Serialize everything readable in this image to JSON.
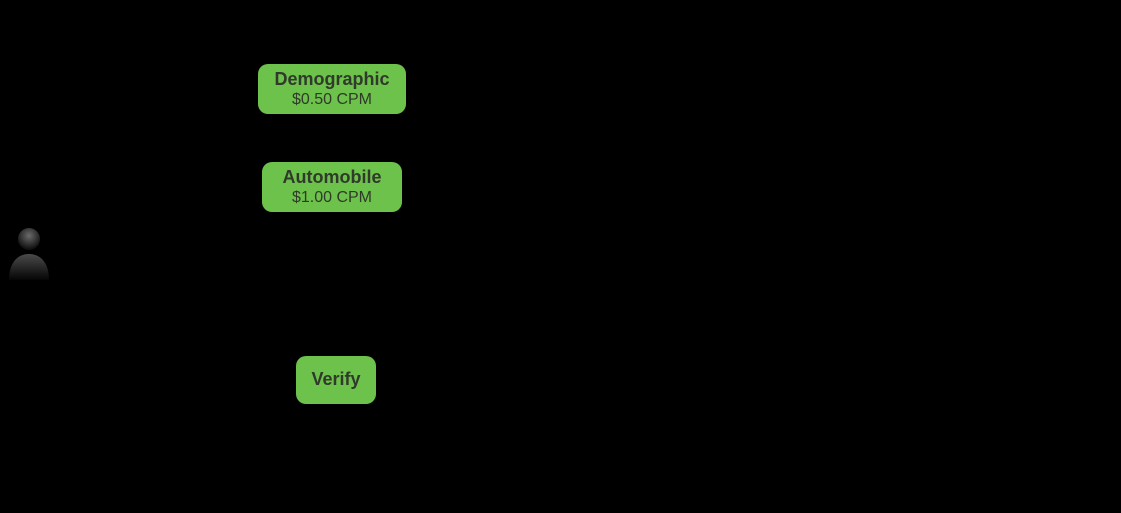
{
  "nodes": {
    "demographic": {
      "title": "Demographic",
      "sub": "$0.50 CPM"
    },
    "automobile": {
      "title": "Automobile",
      "sub": "$1.00 CPM"
    },
    "verify": {
      "title": "Verify"
    }
  }
}
